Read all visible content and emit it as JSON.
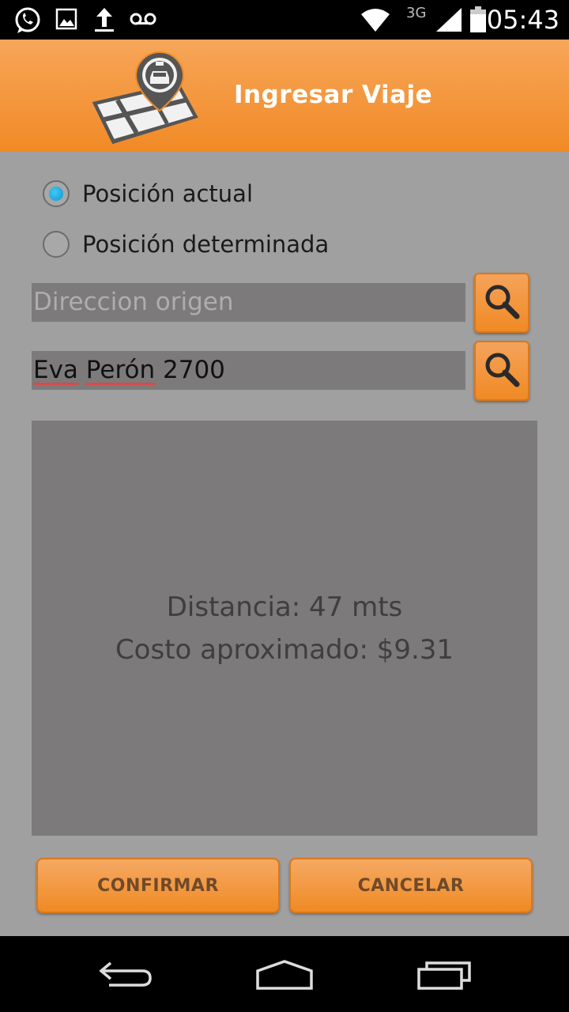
{
  "status_bar": {
    "time": "05:43",
    "network_label": "3G",
    "icons": [
      "whatsapp-icon",
      "image-icon",
      "upload-icon",
      "voicemail-icon",
      "wifi-icon",
      "signal-icon",
      "battery-icon"
    ]
  },
  "header": {
    "title": "Ingresar Viaje",
    "logo": "taxi-map-pin-logo"
  },
  "location_options": {
    "current_label": "Posición actual",
    "specific_label": "Posición determinada",
    "selected": "current"
  },
  "origin": {
    "placeholder": "Direccion origen",
    "value": ""
  },
  "destination": {
    "value_words": [
      "Eva",
      " ",
      "Perón",
      " 2700"
    ]
  },
  "trip_info": {
    "distance_text": "Distancia: 47 mts",
    "cost_text": "Costo aproximado: $9.31"
  },
  "actions": {
    "confirm_label": "CONFIRMAR",
    "cancel_label": "CANCELAR"
  },
  "nav_bar": {
    "icons": [
      "back-icon",
      "home-icon",
      "recents-icon"
    ]
  },
  "colors": {
    "accent_orange": "#f18a26",
    "content_bg": "#a0a0a0",
    "field_bg": "#7c7a7b",
    "radio_selected": "#0a97d4"
  }
}
